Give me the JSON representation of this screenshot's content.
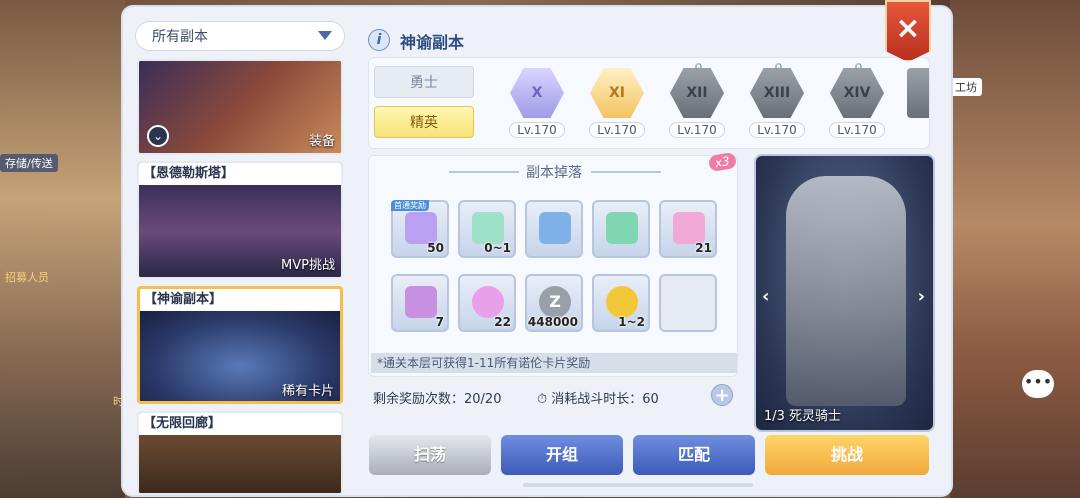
{
  "side_labels": {
    "storage": "存储/传送",
    "recruit": "招募人员",
    "workshop": "工坊",
    "time": "时"
  },
  "dropdown": {
    "label": "所有副本"
  },
  "dungeons": [
    {
      "name": "",
      "tag": "装备"
    },
    {
      "name": "【恩德勒斯塔】",
      "tag": "MVP挑战"
    },
    {
      "name": "【神谕副本】",
      "tag": "稀有卡片"
    },
    {
      "name": "【无限回廊】",
      "tag": ""
    }
  ],
  "main": {
    "title": "神谕副本",
    "info_icon": "i"
  },
  "close": {
    "icon": "×"
  },
  "difficulty": {
    "warrior": "勇士",
    "elite": "精英"
  },
  "levels": [
    {
      "numeral": "X",
      "level": "Lv.170",
      "locked": false
    },
    {
      "numeral": "XI",
      "level": "Lv.170",
      "locked": false
    },
    {
      "numeral": "XII",
      "level": "Lv.170",
      "locked": true
    },
    {
      "numeral": "XIII",
      "level": "Lv.170",
      "locked": true
    },
    {
      "numeral": "XIV",
      "level": "Lv.170",
      "locked": true
    }
  ],
  "drops": {
    "title": "副本掉落",
    "multiplier": "x3",
    "first_badge": "首通奖励",
    "items": [
      {
        "count": "50",
        "color": "#b9a0f0"
      },
      {
        "count": "0~1",
        "color": "#9fe0c8"
      },
      {
        "count": "",
        "color": "#7fb0e8"
      },
      {
        "count": "",
        "color": "#7fd6b0"
      },
      {
        "count": "21",
        "color": "#f0a8d8"
      },
      {
        "count": "7",
        "color": "#c890e0"
      },
      {
        "count": "22",
        "color": "#e8a0e8"
      },
      {
        "count": "448000",
        "color": "#9aa0a8"
      },
      {
        "count": "1~2",
        "color": "#f2c838"
      },
      {
        "count": "",
        "color": "#e6ebf3"
      }
    ],
    "note": "*通关本层可获得1-11所有诺伦卡片奖励"
  },
  "stats": {
    "remaining": "剩余奖励次数：20/20",
    "duration": "消耗战斗时长：60"
  },
  "boss": {
    "label": "1/3 死灵骑士"
  },
  "actions": {
    "sweep": "扫荡",
    "team": "开组",
    "match": "匹配",
    "challenge": "挑战"
  }
}
